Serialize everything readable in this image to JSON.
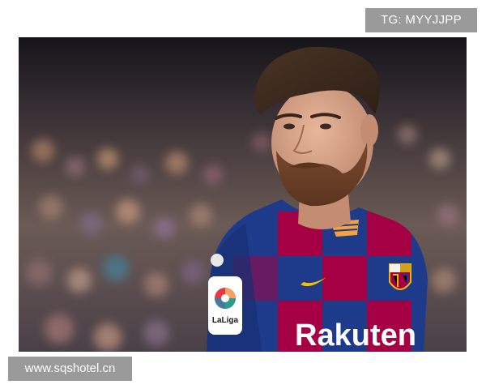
{
  "watermarks": {
    "top_label": "TG: MYYJJPP",
    "bottom_label": "www.sqshotel.cn"
  },
  "photo": {
    "jersey_sponsor": "Rakuten",
    "sleeve_patch": "LaLiga"
  },
  "colors": {
    "watermark_bg": "#9a9a9a",
    "jersey_blue": "#1e3a8a",
    "jersey_red": "#a50044",
    "crest_gold": "#f2b705",
    "crowd_dark": "#2a2730"
  }
}
